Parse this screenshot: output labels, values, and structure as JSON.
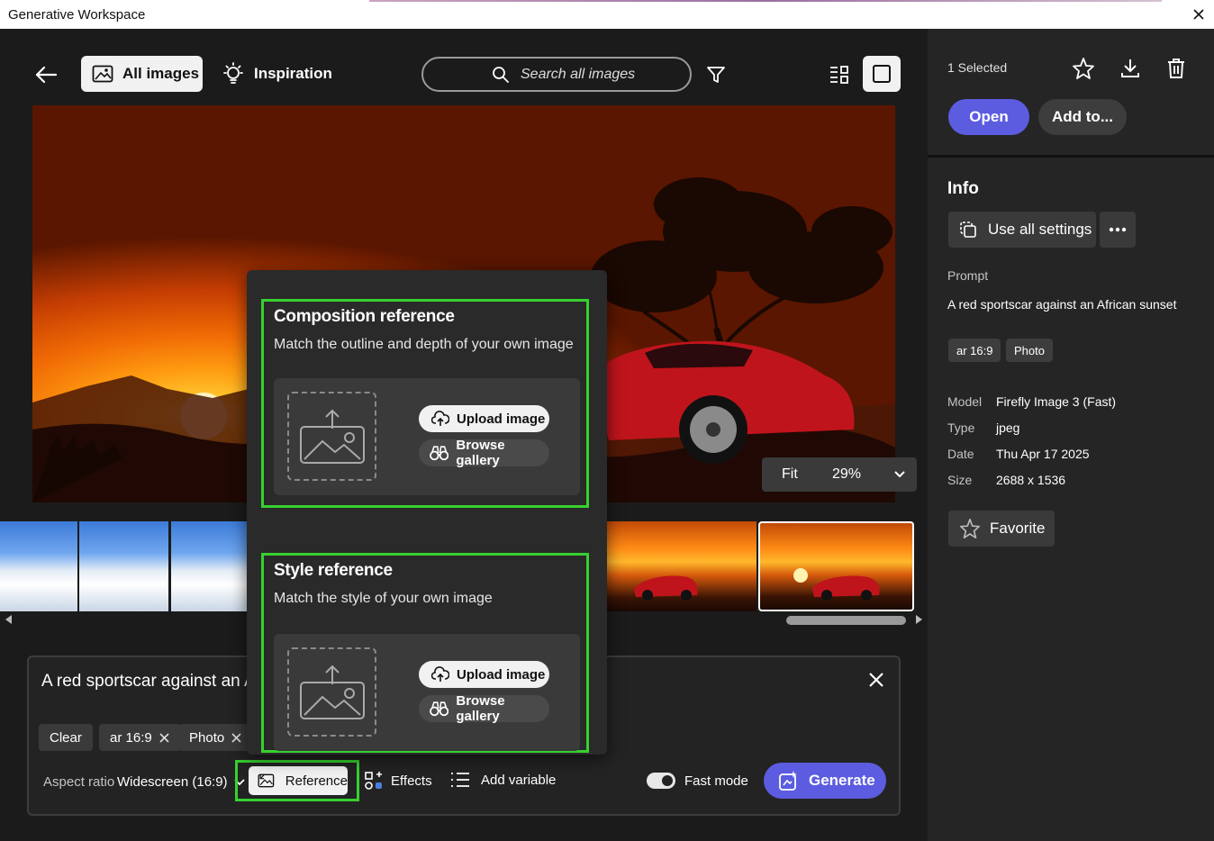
{
  "window": {
    "title": "Generative Workspace"
  },
  "toolbar": {
    "all_images_label": "All images",
    "inspiration_label": "Inspiration",
    "search_placeholder": "Search all images"
  },
  "viewer": {
    "fit_label": "Fit",
    "zoom": "29%"
  },
  "prompt_panel": {
    "prompt_text": "A red sportscar against an African sunset",
    "chips": [
      {
        "label": "Clear"
      },
      {
        "label": "ar 16:9"
      },
      {
        "label": "Photo"
      }
    ],
    "aspect_label": "Aspect ratio",
    "aspect_value": "Widescreen (16:9)",
    "reference_label": "Reference",
    "effects_label": "Effects",
    "add_variable_label": "Add variable",
    "fast_mode_label": "Fast mode",
    "generate_label": "Generate"
  },
  "popover": {
    "composition": {
      "title": "Composition reference",
      "description": "Match the outline and depth of your own image",
      "upload_label": "Upload image",
      "browse_label": "Browse gallery"
    },
    "style": {
      "title": "Style reference",
      "description": "Match the style of your own image",
      "upload_label": "Upload image",
      "browse_label": "Browse gallery"
    }
  },
  "right_panel": {
    "selected_count": "1 Selected",
    "open_label": "Open",
    "add_to_label": "Add to...",
    "info_title": "Info",
    "use_all_settings_label": "Use all settings",
    "prompt_label": "Prompt",
    "prompt_value": "A red sportscar against an African sunset",
    "tags": [
      "ar 16:9",
      "Photo"
    ],
    "meta": [
      {
        "key": "Model",
        "value": "Firefly Image 3 (Fast)"
      },
      {
        "key": "Type",
        "value": "jpeg"
      },
      {
        "key": "Date",
        "value": "Thu Apr 17 2025"
      },
      {
        "key": "Size",
        "value": "2688 x 1536"
      }
    ],
    "favorite_label": "Favorite"
  },
  "colors": {
    "accent": "#5c5ce0",
    "highlight": "#37d12f",
    "background": "#1b1b1b",
    "panel": "#252525"
  }
}
